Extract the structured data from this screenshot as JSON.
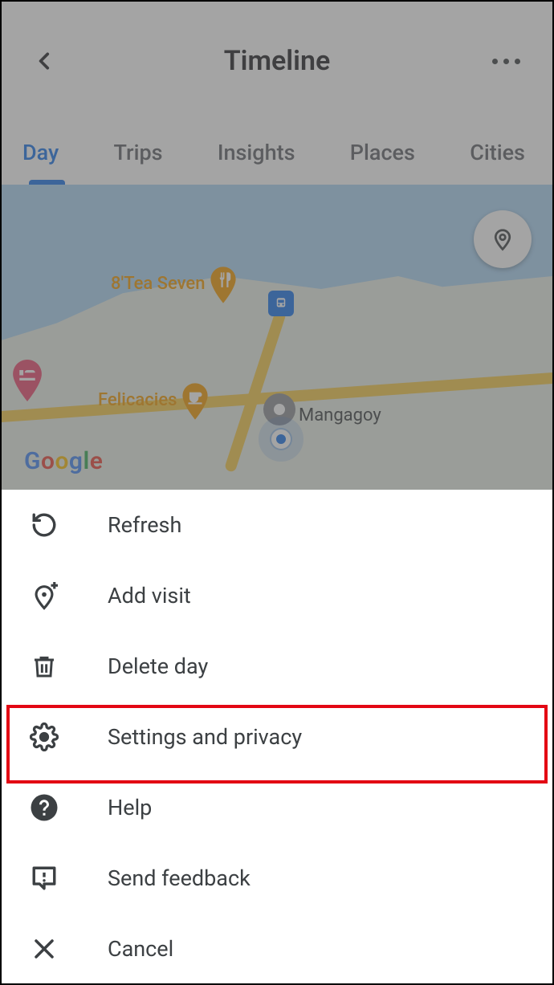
{
  "header": {
    "title": "Timeline"
  },
  "tabs": {
    "items": [
      {
        "label": "Day",
        "active": true
      },
      {
        "label": "Trips"
      },
      {
        "label": "Insights"
      },
      {
        "label": "Places"
      },
      {
        "label": "Cities"
      }
    ]
  },
  "map": {
    "poi1": "8'Tea Seven",
    "poi2": "Felicacies",
    "city_label": "Mangagoy",
    "attribution": "Google"
  },
  "menu": {
    "items": [
      {
        "icon": "refresh-icon",
        "label": "Refresh"
      },
      {
        "icon": "add-visit-icon",
        "label": "Add visit"
      },
      {
        "icon": "trash-icon",
        "label": "Delete day"
      },
      {
        "icon": "gear-icon",
        "label": "Settings and privacy"
      },
      {
        "icon": "help-icon",
        "label": "Help"
      },
      {
        "icon": "feedback-icon",
        "label": "Send feedback"
      },
      {
        "icon": "close-icon",
        "label": "Cancel"
      }
    ],
    "highlighted_index": 3
  }
}
